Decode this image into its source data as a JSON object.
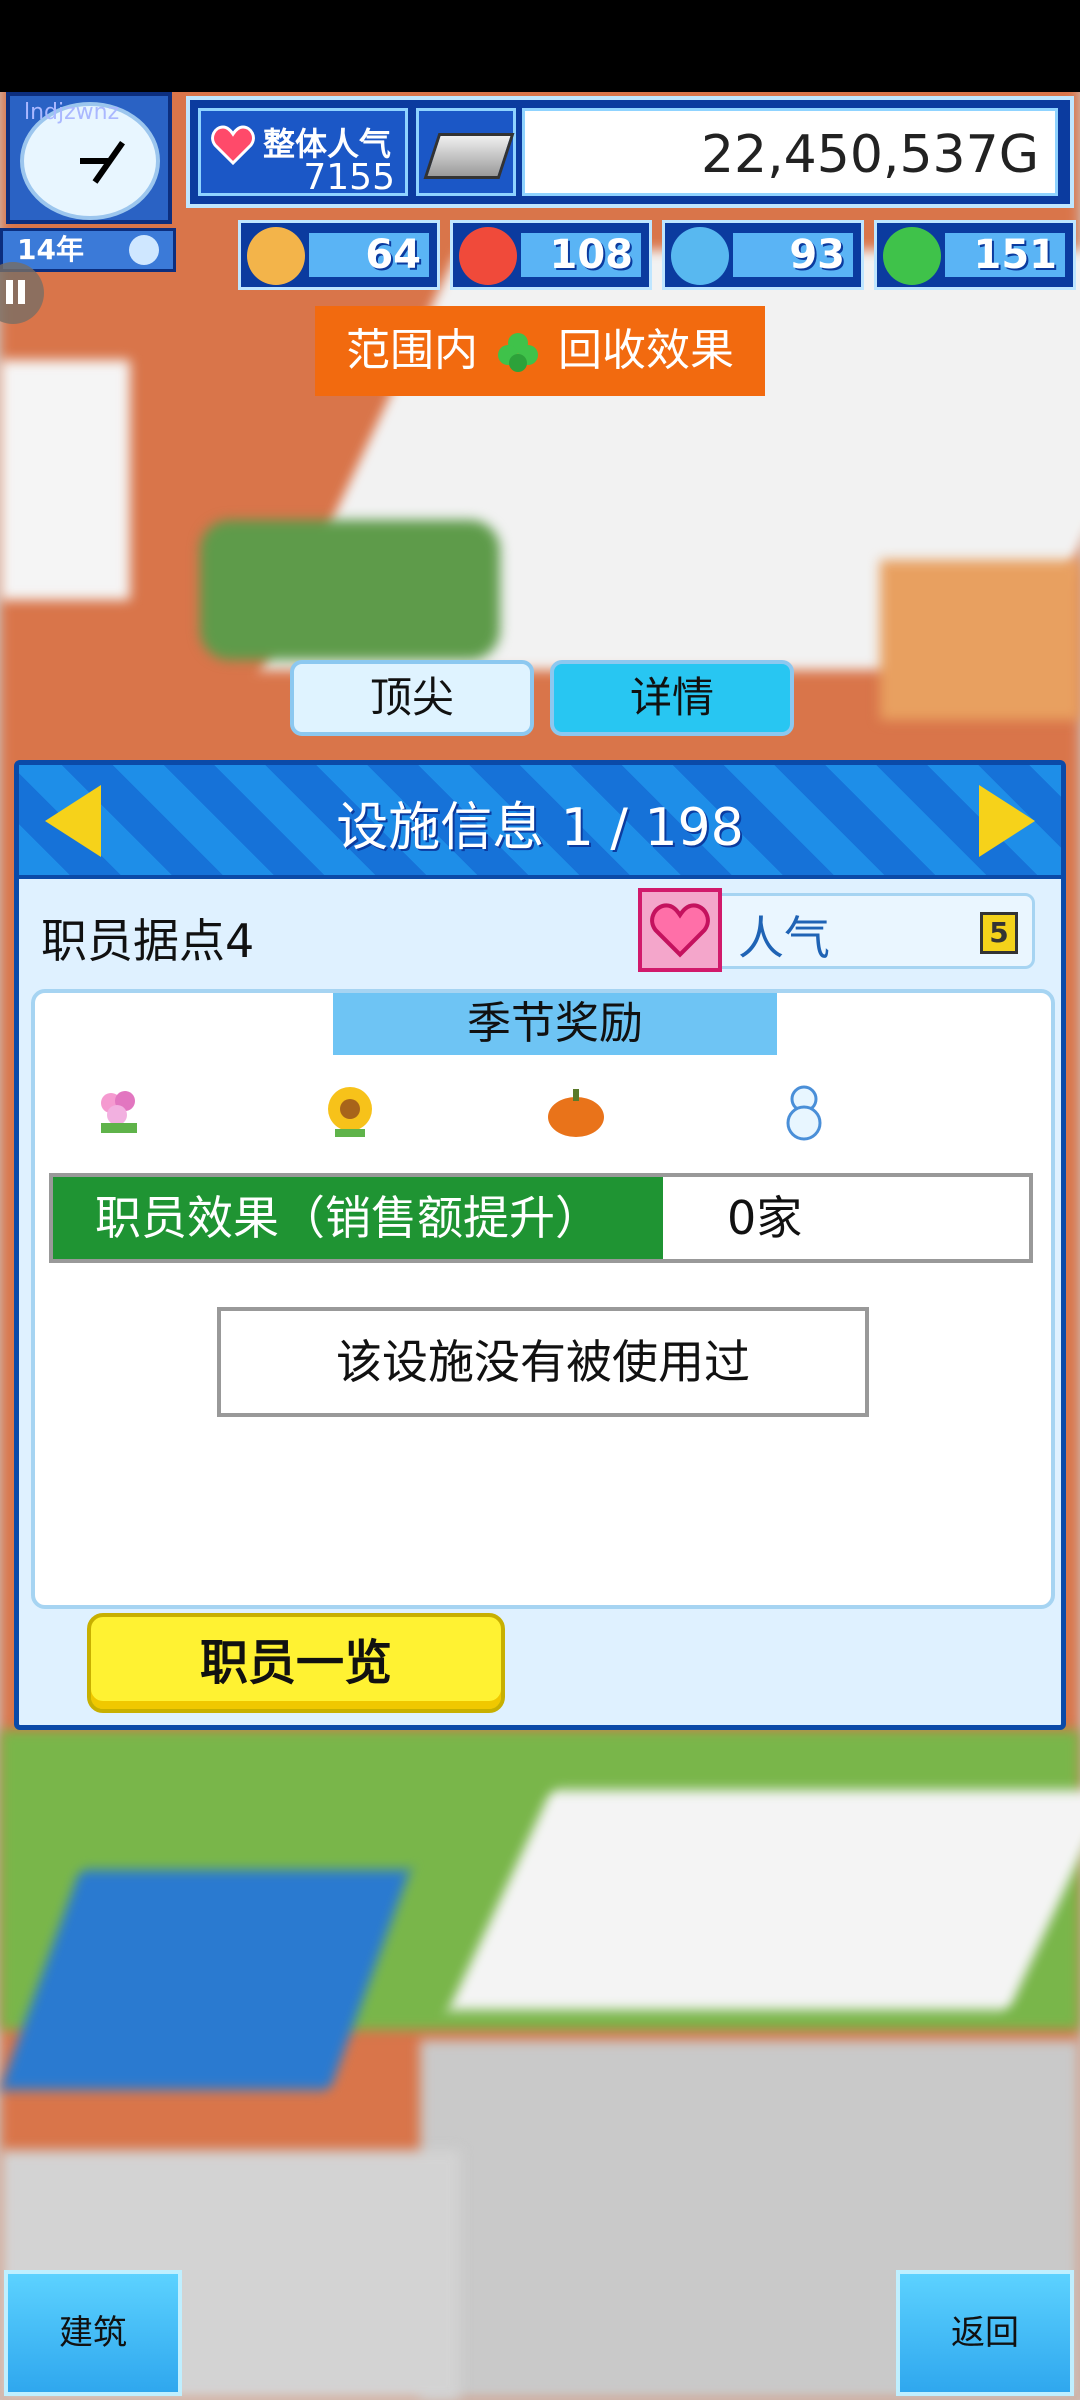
{
  "hud": {
    "watermark": "lndjzwnz",
    "year": "14年",
    "popularity_label": "整体人气",
    "popularity_value": "7155",
    "money": "22,450,537G",
    "stats": [
      {
        "icon": "smile-icon",
        "value": "64",
        "color": "#f3b44a"
      },
      {
        "icon": "flame-icon",
        "value": "108",
        "color": "#f04a3a"
      },
      {
        "icon": "water-drop-icon",
        "value": "93",
        "color": "#58b8f0"
      },
      {
        "icon": "clover-icon",
        "value": "151",
        "color": "#3fc24a"
      }
    ]
  },
  "banner": {
    "prefix": "范围内",
    "suffix": "回收效果",
    "icon": "clover-icon"
  },
  "tabs": {
    "top": "顶尖",
    "detail": "详情"
  },
  "panel": {
    "title": "设施信息 1 / 198",
    "facility_name": "职员据点4",
    "category_label": "人气",
    "category_level": "5",
    "season_title": "季节奖励",
    "season_icons": [
      "flower-icon",
      "sunflower-icon",
      "pumpkin-icon",
      "snowman-icon"
    ],
    "effect_label": "职员效果（销售额提升）",
    "effect_value": "0家",
    "unused_text": "该设施没有被使用过",
    "staff_button": "职员一览"
  },
  "footer": {
    "build": "建筑",
    "back": "返回"
  },
  "colors": {
    "accent_blue": "#0b3b9f",
    "effect_green": "#1f9433",
    "banner_orange": "#f26a0f",
    "button_yellow": "#fff232"
  }
}
